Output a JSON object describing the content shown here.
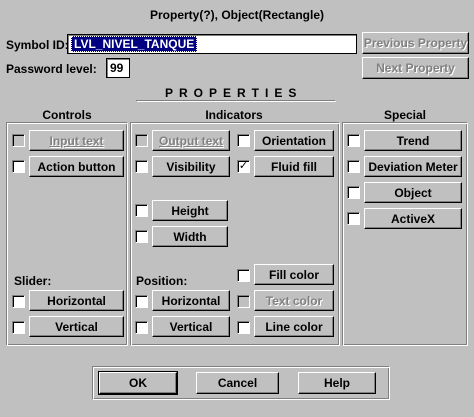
{
  "dialog": {
    "title": "Property(?), Object(Rectangle)"
  },
  "symbol": {
    "label": "Symbol ID:",
    "value": "LVL_NIVEL_TANQUE"
  },
  "password": {
    "label": "Password level:",
    "value": "99"
  },
  "nav": {
    "previous": "Previous Property",
    "next": "Next Property"
  },
  "properties_header": "PROPERTIES",
  "controls": {
    "heading": "Controls",
    "input_text": "Input text",
    "action_button": "Action button",
    "slider_label": "Slider:",
    "horizontal": "Horizontal",
    "vertical": "Vertical"
  },
  "indicators": {
    "heading": "Indicators",
    "output_text": "Output text",
    "visibility": "Visibility",
    "height": "Height",
    "width": "Width",
    "orientation": "Orientation",
    "fluid_fill": "Fluid fill",
    "position_label": "Position:",
    "horizontal": "Horizontal",
    "vertical": "Vertical",
    "fill_color": "Fill color",
    "text_color": "Text color",
    "line_color": "Line color"
  },
  "special": {
    "heading": "Special",
    "trend": "Trend",
    "deviation_meter": "Deviation Meter",
    "object": "Object",
    "activex": "ActiveX"
  },
  "checks": {
    "fluid_fill": "✓"
  },
  "footer": {
    "ok": "OK",
    "cancel": "Cancel",
    "help": "Help"
  },
  "colors": {
    "face": "#c0c0c0",
    "selection": "#000080",
    "disabled_text": "#808080"
  }
}
